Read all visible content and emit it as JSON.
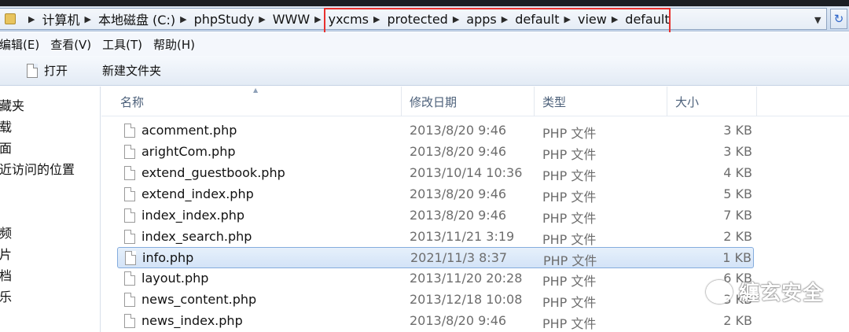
{
  "address_bar": {
    "crumbs": [
      "计算机",
      "本地磁盘 (C:)",
      "phpStudy",
      "WWW",
      "yxcms",
      "protected",
      "apps",
      "default",
      "view",
      "default"
    ]
  },
  "menu": [
    "编辑(E)",
    "查看(V)",
    "工具(T)",
    "帮助(H)"
  ],
  "toolbar": {
    "open_label": "打开",
    "new_folder_label": "新建文件夹"
  },
  "nav_pane": [
    "藏夹",
    "载",
    "面",
    "近访问的位置",
    "频",
    "片",
    "档",
    "乐"
  ],
  "columns": {
    "name": "名称",
    "date": "修改日期",
    "type": "类型",
    "size": "大小"
  },
  "files": [
    {
      "name": "acomment.php",
      "date": "2013/8/20 9:46",
      "type": "PHP 文件",
      "size": "3 KB"
    },
    {
      "name": "arightCom.php",
      "date": "2013/8/20 9:46",
      "type": "PHP 文件",
      "size": "3 KB"
    },
    {
      "name": "extend_guestbook.php",
      "date": "2013/10/14 10:36",
      "type": "PHP 文件",
      "size": "4 KB"
    },
    {
      "name": "extend_index.php",
      "date": "2013/8/20 9:46",
      "type": "PHP 文件",
      "size": "5 KB"
    },
    {
      "name": "index_index.php",
      "date": "2013/8/20 9:46",
      "type": "PHP 文件",
      "size": "7 KB"
    },
    {
      "name": "index_search.php",
      "date": "2013/11/21 3:19",
      "type": "PHP 文件",
      "size": "2 KB"
    },
    {
      "name": "info.php",
      "date": "2021/11/3 8:37",
      "type": "PHP 文件",
      "size": "1 KB",
      "selected": true
    },
    {
      "name": "layout.php",
      "date": "2013/11/20 20:28",
      "type": "PHP 文件",
      "size": "6 KB"
    },
    {
      "name": "news_content.php",
      "date": "2013/12/18 10:08",
      "type": "PHP 文件",
      "size": "3 KB"
    },
    {
      "name": "news_index.php",
      "date": "2013/8/20 9:46",
      "type": "PHP 文件",
      "size": "2 KB"
    }
  ],
  "watermark": "纏玄安全",
  "colors": {
    "highlight_box": "#e8302d",
    "selection": "#d3e3f7"
  }
}
